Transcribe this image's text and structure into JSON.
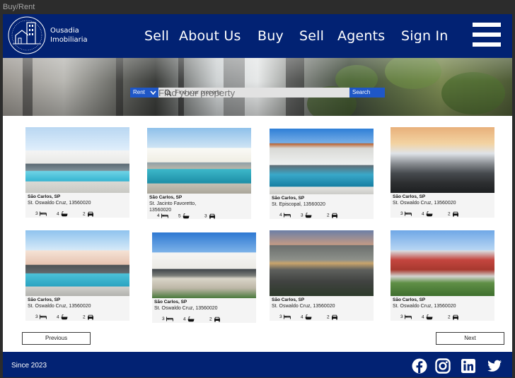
{
  "frame_label": "Buy/Rent",
  "brand": {
    "line1": "Ousadia",
    "line2": "Imobiliaria"
  },
  "nav": [
    "Sell",
    "About Us",
    "Buy",
    "Sell",
    "Agents",
    "Sign In"
  ],
  "search": {
    "mode": "Rent",
    "placeholder": "Find your property",
    "button": "Search"
  },
  "listings": [
    {
      "city": "São Carlos, SP",
      "address": "St. Oswaldo Cruz, 13560020",
      "beds": "3",
      "baths": "4",
      "garage": "2"
    },
    {
      "city": "São Carlos, SP",
      "address": "St. Jacinto Favoretto, 13560020",
      "beds": "4",
      "baths": "5",
      "garage": "3"
    },
    {
      "city": "São Carlos, SP",
      "address": "St.  Episcopal, 13560020",
      "beds": "4",
      "baths": "3",
      "garage": "2"
    },
    {
      "city": "São Carlos, SP",
      "address": "St. Oswaldo Cruz, 13560020",
      "beds": "3",
      "baths": "4",
      "garage": "2"
    },
    {
      "city": "São Carlos, SP",
      "address": "St. Oswaldo Cruz, 13560020",
      "beds": "3",
      "baths": "4",
      "garage": "2"
    },
    {
      "city": "São Carlos, SP",
      "address": "St. Oswaldo Cruz, 13560020",
      "beds": "3",
      "baths": "4",
      "garage": "2"
    },
    {
      "city": "São Carlos, SP",
      "address": "St. Oswaldo Cruz, 13560020",
      "beds": "3",
      "baths": "4",
      "garage": "2"
    },
    {
      "city": "São Carlos, SP",
      "address": "St. Oswaldo Cruz, 13560020",
      "beds": "3",
      "baths": "4",
      "garage": "2"
    }
  ],
  "pagination": {
    "previous": "Previous",
    "next": "Next"
  },
  "footer": {
    "since": "Since 2023"
  },
  "social_icons": [
    "facebook-icon",
    "instagram-icon",
    "linkedin-icon",
    "twitter-icon"
  ],
  "colors": {
    "brand_navy": "#022273",
    "accent_blue": "#1f57c7"
  }
}
